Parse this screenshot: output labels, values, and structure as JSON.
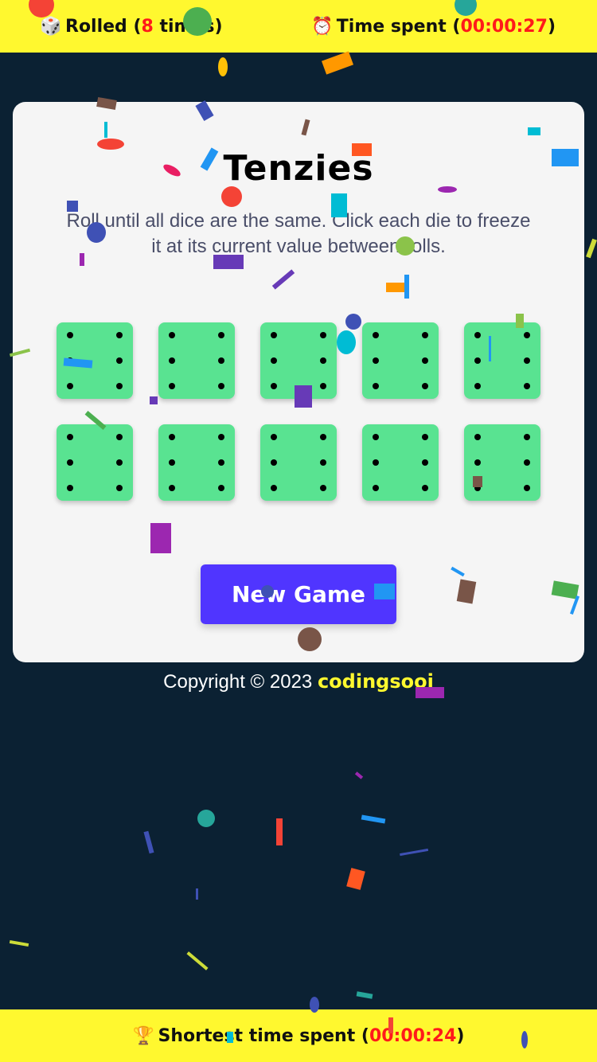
{
  "header": {
    "dice_icon": "dice-icon",
    "rolled_prefix": "Rolled (",
    "rolled_count": "8",
    "rolled_suffix": " times)",
    "clock_icon": "alarm-clock-icon",
    "time_prefix": "Time spent (",
    "time_value": "00:00:27",
    "time_suffix": ")"
  },
  "game": {
    "title": "Tenzies",
    "instructions": "Roll until all dice are the same. Click each die to freeze it at its current value between rolls.",
    "dice": [
      6,
      6,
      6,
      6,
      6,
      6,
      6,
      6,
      6,
      6
    ],
    "die_color": "#59e391",
    "new_game_label": "New Game",
    "button_color": "#5035ff"
  },
  "footer": {
    "copyright": "Copyright © 2023 ",
    "brand": "codingsooi"
  },
  "bottom": {
    "trophy_icon": "trophy-icon",
    "best_prefix": "Shortest time spent (",
    "best_value": "00:00:24",
    "best_suffix": ")"
  },
  "colors": {
    "background": "#0b2133",
    "bar": "#fff82f",
    "accent_red": "#ff1a1a"
  }
}
